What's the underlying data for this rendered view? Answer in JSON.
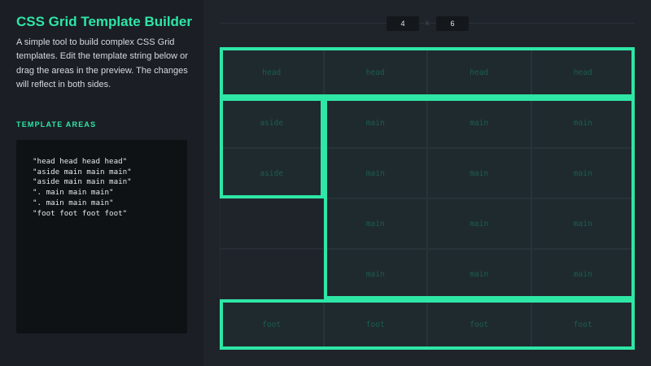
{
  "sidebar": {
    "title": "CSS Grid Template Builder",
    "description": "A simple tool to build complex CSS Grid templates. Edit the template string below or drag the areas in the preview. The changes will reflect in both sides.",
    "section_label": "TEMPLATE AREAS",
    "template": "\"head head head head\"\n\"aside main main main\"\n\"aside main main main\"\n\". main main main\"\n\". main main main\"\n\"foot foot foot foot\""
  },
  "controls": {
    "columns": "4",
    "separator": "x",
    "rows": "6"
  },
  "grid": {
    "cells": [
      "head",
      "head",
      "head",
      "head",
      "aside",
      "main",
      "main",
      "main",
      "aside",
      "main",
      "main",
      "main",
      "",
      "main",
      "main",
      "main",
      "",
      "main",
      "main",
      "main",
      "foot",
      "foot",
      "foot",
      "foot"
    ]
  },
  "colors": {
    "accent": "#2ee6a6",
    "background": "#1f232a",
    "sidebar": "#1b1f25",
    "editor": "#0f1215"
  }
}
